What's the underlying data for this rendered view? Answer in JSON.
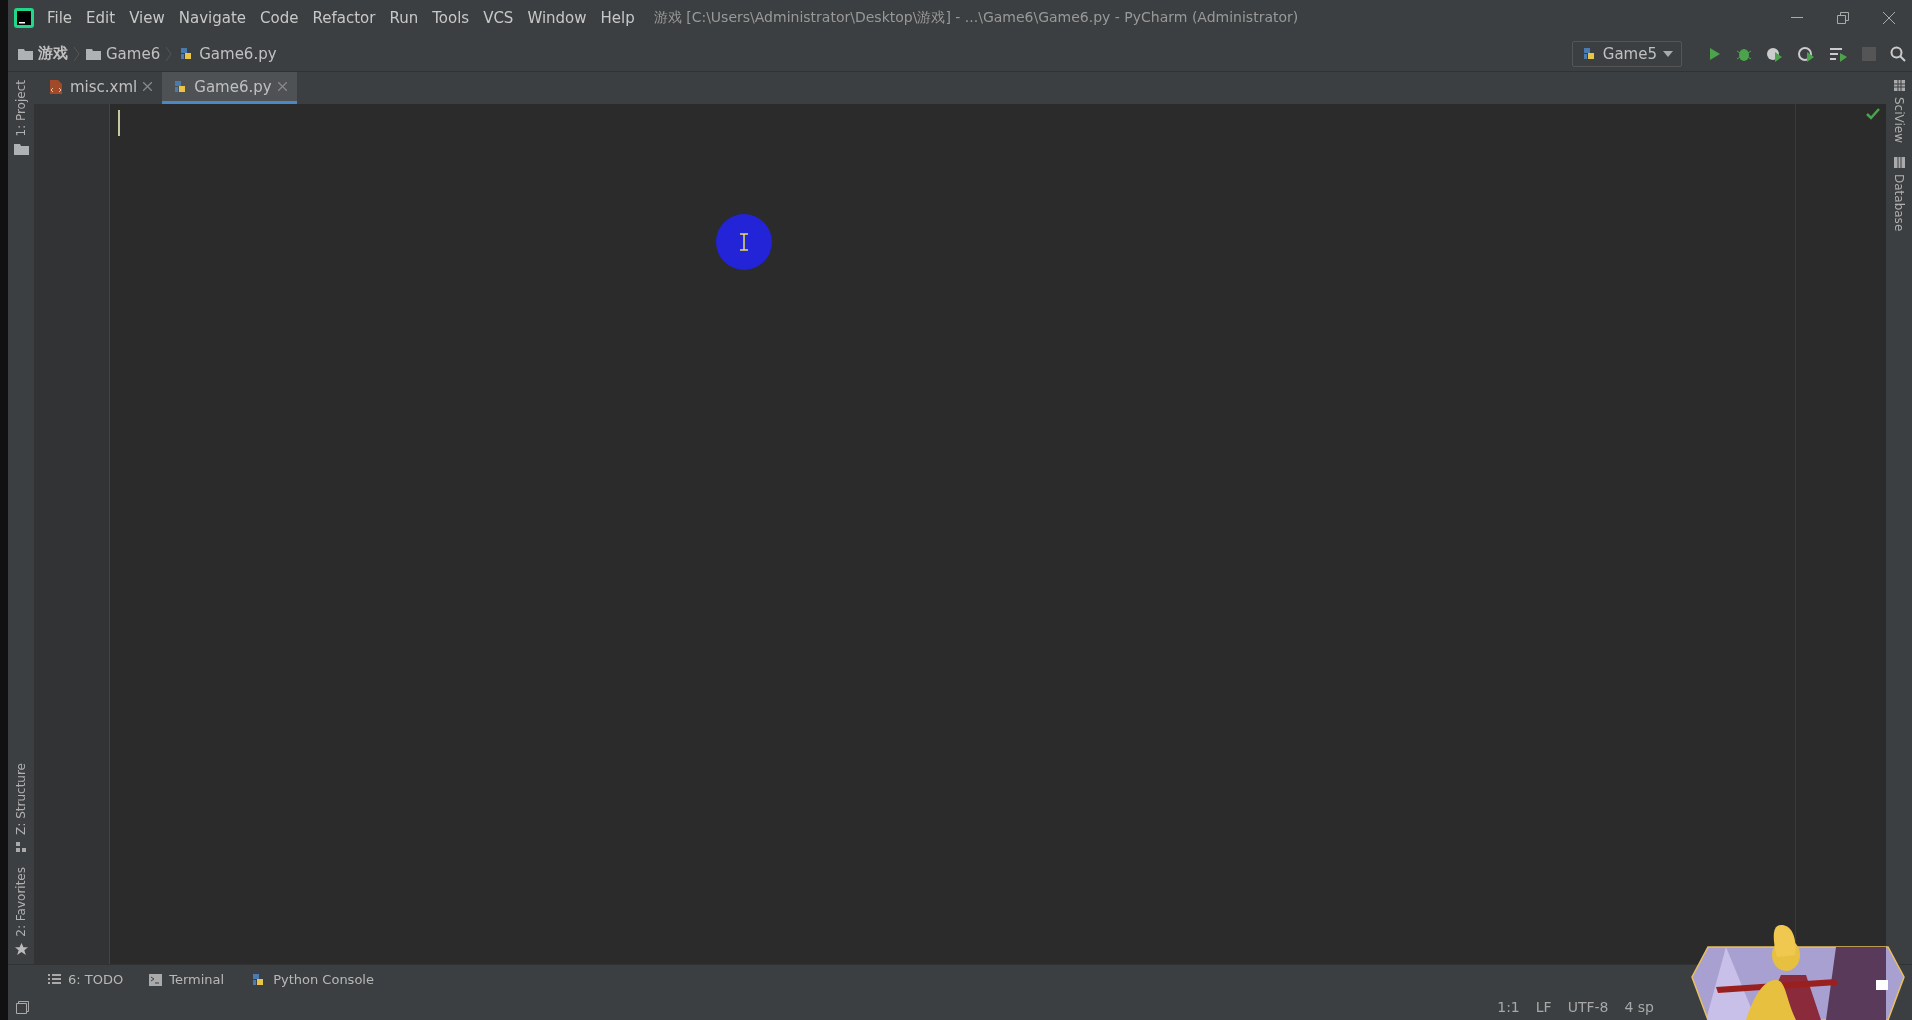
{
  "menu": [
    "File",
    "Edit",
    "View",
    "Navigate",
    "Code",
    "Refactor",
    "Run",
    "Tools",
    "VCS",
    "Window",
    "Help"
  ],
  "window_title": "游戏 [C:\\Users\\Administrator\\Desktop\\游戏] - ...\\Game6\\Game6.py - PyCharm (Administrator)",
  "breadcrumbs": [
    {
      "label": "游戏",
      "kind": "folder",
      "bold": true
    },
    {
      "label": "Game6",
      "kind": "folder",
      "bold": false
    },
    {
      "label": "Game6.py",
      "kind": "python",
      "bold": false
    }
  ],
  "run_config": "Game5",
  "tabs": [
    {
      "label": "misc.xml",
      "kind": "xml",
      "selected": false
    },
    {
      "label": "Game6.py",
      "kind": "python",
      "selected": true
    }
  ],
  "left_tools_top": [
    "1: Project"
  ],
  "left_tools_bottom": [
    {
      "label": "Z: Structure",
      "kind": "structure"
    },
    {
      "label": "2: Favorites",
      "kind": "favorites"
    }
  ],
  "right_tools": [
    {
      "label": "SciView",
      "kind": "sciview"
    },
    {
      "label": "Database",
      "kind": "database"
    }
  ],
  "bottom_tools": [
    {
      "label": "6: TODO",
      "kind": "todo"
    },
    {
      "label": "Terminal",
      "kind": "terminal"
    },
    {
      "label": "Python Console",
      "kind": "python"
    }
  ],
  "status_bar": [
    "1:1",
    "LF",
    "UTF-8",
    "4 sp"
  ],
  "overlay": {
    "kind": "picture"
  }
}
